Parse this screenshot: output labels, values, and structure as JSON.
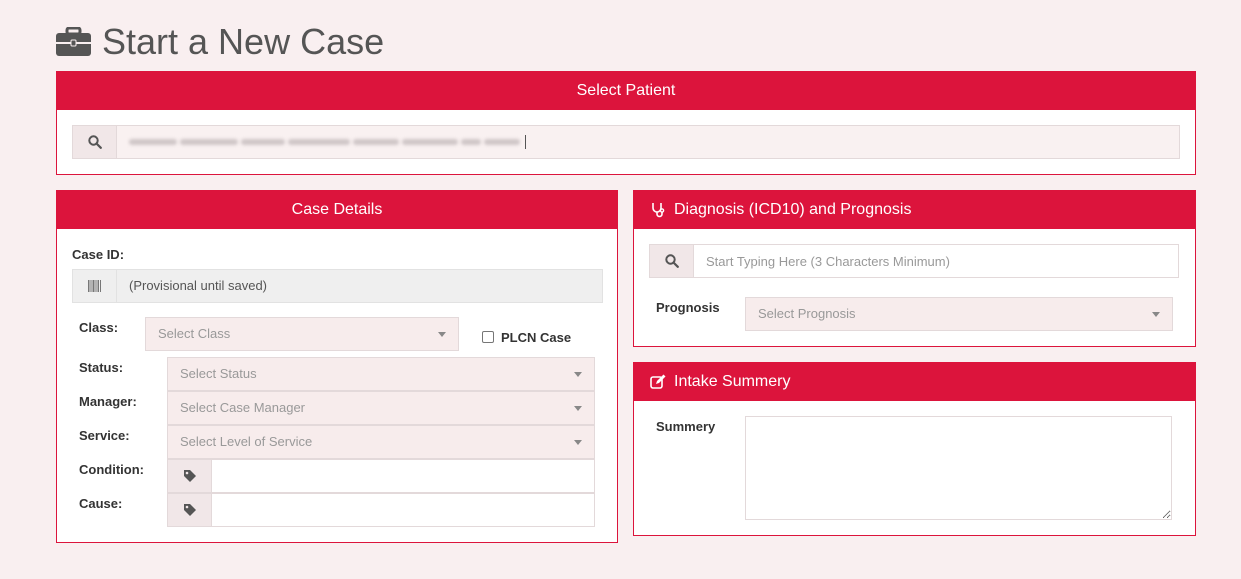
{
  "page": {
    "title": "Start a New Case"
  },
  "select_patient": {
    "heading": "Select Patient"
  },
  "case_details": {
    "heading": "Case Details",
    "case_id_label": "Case ID:",
    "case_id_value": "(Provisional until saved)",
    "class_label": "Class:",
    "class_placeholder": "Select Class",
    "plcn_label": "PLCN Case",
    "status_label": "Status:",
    "status_placeholder": "Select Status",
    "manager_label": "Manager:",
    "manager_placeholder": "Select Case Manager",
    "service_label": "Service:",
    "service_placeholder": "Select Level of Service",
    "condition_label": "Condition:",
    "cause_label": "Cause:"
  },
  "diagnosis": {
    "heading": "Diagnosis (ICD10) and Prognosis",
    "search_placeholder": "Start Typing Here (3 Characters Minimum)",
    "prognosis_label": "Prognosis",
    "prognosis_placeholder": "Select Prognosis"
  },
  "intake": {
    "heading": "Intake Summery",
    "summary_label": "Summery"
  },
  "colors": {
    "accent": "#dc143c",
    "background": "#f9eff0"
  },
  "icons": [
    "briefcase-icon",
    "search-icon",
    "barcode-icon",
    "tag-icon",
    "stethoscope-icon",
    "edit-icon"
  ]
}
